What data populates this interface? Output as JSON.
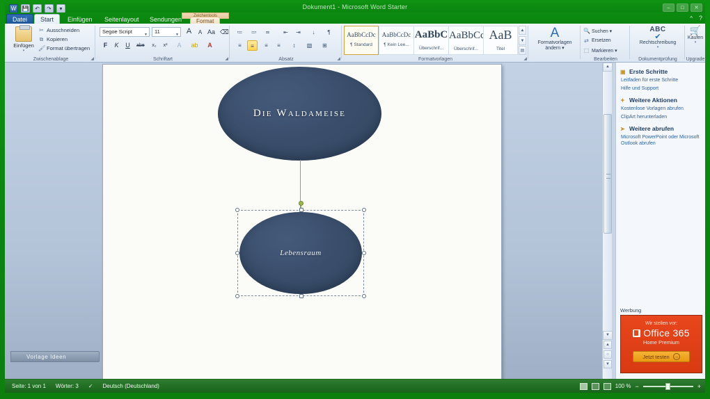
{
  "window": {
    "title": "Dokument1 - Microsoft Word Starter",
    "minimize": "–",
    "maximize": "□",
    "close": "✕"
  },
  "quick_access": {
    "items": [
      {
        "name": "word-logo",
        "glyph": "W"
      },
      {
        "name": "save",
        "glyph": "💾"
      },
      {
        "name": "undo",
        "glyph": "↶"
      },
      {
        "name": "redo",
        "glyph": "↷"
      },
      {
        "name": "customize",
        "glyph": "▾"
      }
    ]
  },
  "tabs": {
    "file": "Datei",
    "items": [
      "Start",
      "Einfügen",
      "Seitenlayout",
      "Sendungen"
    ],
    "contextual_group": "Zeichentools",
    "contextual_tab": "Format",
    "active": "Start",
    "help_glyph": "?",
    "minimize_ribbon_glyph": "^"
  },
  "ribbon": {
    "clipboard": {
      "label": "Zwischenablage",
      "paste": "Einfügen",
      "cut": "Ausschneiden",
      "copy": "Kopieren",
      "format_painter": "Format übertragen",
      "cut_icon": "✂",
      "copy_icon": "⧉",
      "painter_icon": "🖌",
      "dialog_launcher": "◢"
    },
    "font": {
      "label": "Schriftart",
      "font_name": "Segoe Script",
      "font_size": "11",
      "grow": "A",
      "shrink": "A",
      "change_case": "Aa",
      "clear_formatting": "⌫",
      "bold": "F",
      "italic": "K",
      "underline": "U",
      "strikethrough": "abe",
      "subscript": "x₂",
      "superscript": "x²",
      "text_effects": "A",
      "highlight": "ab",
      "font_color": "A",
      "dialog_launcher": "◢"
    },
    "paragraph": {
      "label": "Absatz",
      "bullets": "≔",
      "numbering": "≕",
      "multilevel": "≖",
      "decrease_indent": "⇤",
      "increase_indent": "⇥",
      "sort": "↓",
      "show_marks": "¶",
      "align_left": "≡",
      "align_center": "≡",
      "align_right": "≡",
      "justify": "≡",
      "line_spacing": "↕",
      "shading": "▧",
      "borders": "⊞",
      "dialog_launcher": "◢"
    },
    "styles": {
      "label": "Formatvorlagen",
      "gallery": [
        {
          "preview": "AaBbCcDc",
          "name": "¶ Standard",
          "selected": true,
          "size": "small"
        },
        {
          "preview": "AaBbCcDc",
          "name": "¶ Kein Lee...",
          "selected": false,
          "size": "small"
        },
        {
          "preview": "AaBbC",
          "name": "Überschrif...",
          "selected": false,
          "size": "big"
        },
        {
          "preview": "AaBbCc",
          "name": "Überschrif...",
          "selected": false,
          "size": "big"
        },
        {
          "preview": "AaB",
          "name": "Titel",
          "selected": false,
          "size": "huge"
        }
      ],
      "scroll_up": "▲",
      "scroll_down": "▼",
      "more": "▤",
      "dialog_launcher": "◢"
    },
    "change_styles": {
      "label": "",
      "title": "Formatvorlagen",
      "subtitle": "ändern ▾",
      "icon": "A"
    },
    "editing": {
      "label": "Bearbeiten",
      "find": "Suchen ▾",
      "replace": "Ersetzen",
      "select": "Markieren ▾",
      "find_icon": "🔍",
      "replace_icon": "⇄",
      "select_icon": "⬚"
    },
    "proofing": {
      "label": "Dokumentprüfung",
      "button": "Rechtschreibung",
      "button2": "▾",
      "abc": "ABC",
      "check": "✔"
    },
    "upgrade": {
      "label": "Upgrade",
      "button": "Kaufen",
      "button2": "▾",
      "icon": "🛒"
    }
  },
  "document": {
    "template_tab": "Vorlage Ideen",
    "shapes": [
      {
        "id": "title-ellipse",
        "text": "Die Waldameise",
        "selected": false
      },
      {
        "id": "sub-ellipse",
        "text": "Lebensraum",
        "selected": true
      }
    ]
  },
  "task_pane": {
    "sections": [
      {
        "icon": "▣",
        "heading": "Erste Schritte",
        "links": [
          "Leitfaden für erste Schritte",
          "Hilfe und Support"
        ]
      },
      {
        "icon": "✦",
        "heading": "Weitere Aktionen",
        "links": [
          "Kostenlose Vorlagen abrufen",
          "ClipArt herunterladen"
        ]
      },
      {
        "icon": "➤",
        "heading": "Weitere abrufen",
        "links": [
          "Microsoft PowerPoint oder Microsoft",
          "Outlook abrufen"
        ]
      }
    ],
    "ad_label": "Werbung",
    "ad": {
      "intro": "Wir stellen vor:",
      "product": "Office 365",
      "edition": "Home Premium",
      "cta": "Jetzt testen",
      "cta_arrow": "→",
      "color": "#e8461c"
    }
  },
  "scrollbar": {
    "up": "▲",
    "down": "▼",
    "prev_page": "▲",
    "select_object": "○",
    "next_page": "▼"
  },
  "status_bar": {
    "page": "Seite: 1 von 1",
    "words": "Wörter: 3",
    "proof_icon": "✓",
    "language": "Deutsch (Deutschland)",
    "zoom": "100 %",
    "zoom_out": "−",
    "zoom_in": "+",
    "views": [
      "print-layout",
      "full-screen",
      "web-layout"
    ]
  }
}
